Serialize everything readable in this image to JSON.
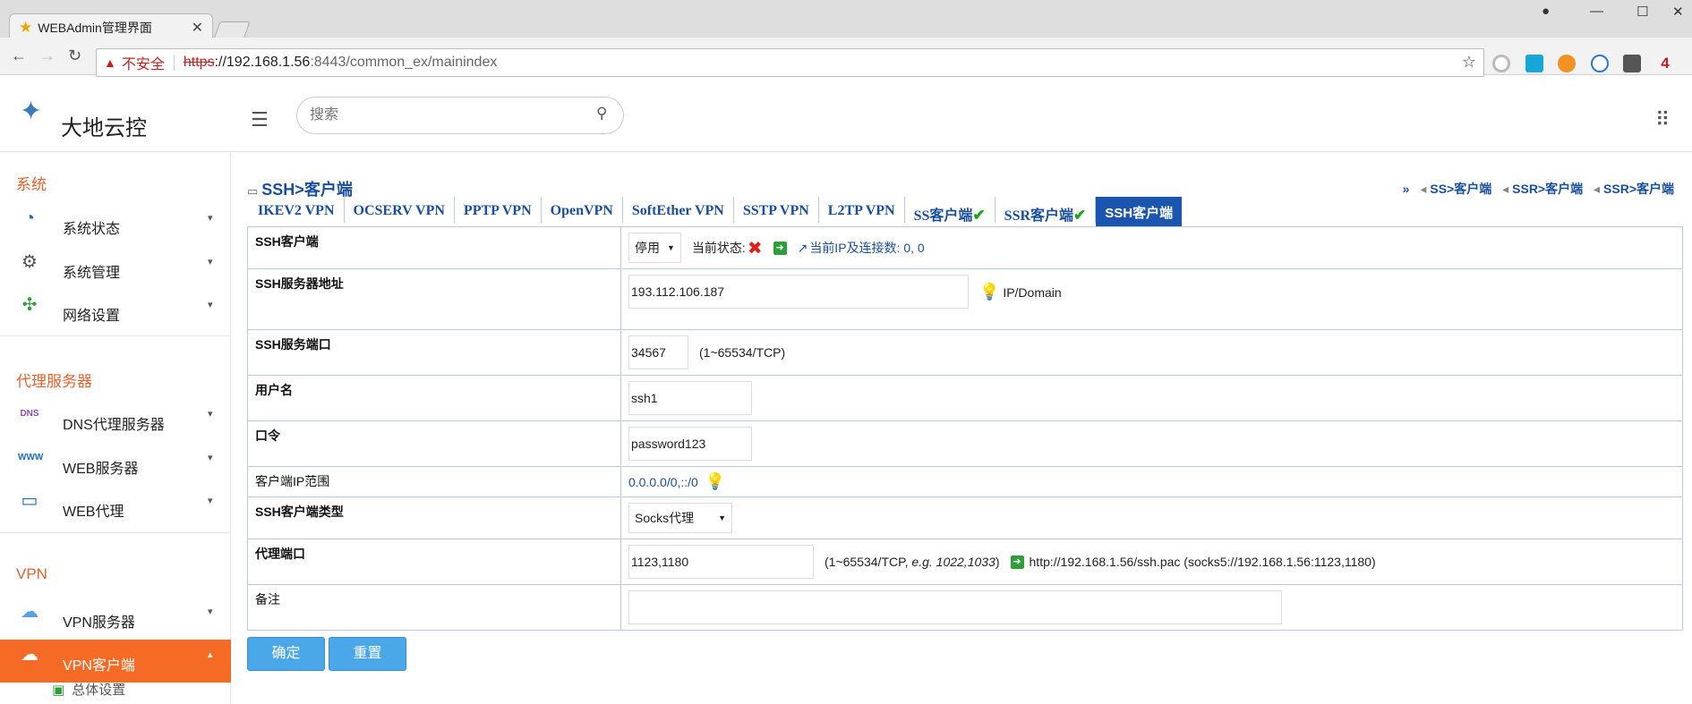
{
  "browser": {
    "tab_title": "WEBAdmin管理界面",
    "close": "✕",
    "warn_glyph": "▲",
    "insecure_label": "不安全",
    "url_scheme": "https",
    "url_host": "://192.168.1.56",
    "url_path": ":8443/common_ex/mainindex",
    "star": "☆",
    "user_icon": "●",
    "minimize": "—",
    "maximize": "☐",
    "window_close": "✕"
  },
  "header": {
    "brand": "大地云控",
    "search_placeholder": "搜索"
  },
  "sidebar": {
    "sections": [
      {
        "title": "系统"
      },
      {
        "title": "代理服务器"
      },
      {
        "title": "VPN"
      }
    ],
    "items": [
      {
        "label": "系统状态",
        "icon": "gauge-icon"
      },
      {
        "label": "系统管理",
        "icon": "gear-icon"
      },
      {
        "label": "网络设置",
        "icon": "network-icon"
      },
      {
        "label": "DNS代理服务器",
        "icon": "dns-icon"
      },
      {
        "label": "WEB服务器",
        "icon": "globe-icon"
      },
      {
        "label": "WEB代理",
        "icon": "monitor-icon"
      },
      {
        "label": "VPN服务器",
        "icon": "cloud-lightning-icon"
      },
      {
        "label": "VPN客户端",
        "icon": "cloud-icon"
      }
    ],
    "sub_item": "总体设置"
  },
  "page": {
    "title": "SSH>客户端",
    "crumb_prefix": "»",
    "crumbs": [
      "SS>客户端",
      "SSR>客户端",
      "SSR>客户端"
    ],
    "tabs": [
      "IKEV2 VPN",
      "OCSERV VPN",
      "PPTP VPN",
      "OpenVPN",
      "SoftEther VPN",
      "SSTP VPN",
      "L2TP VPN",
      "SS客户端",
      "SSR客户端",
      "SSH客户端"
    ],
    "checkmark": "✔"
  },
  "form": {
    "rows": [
      {
        "label": "SSH客户端"
      },
      {
        "label": "SSH服务器地址"
      },
      {
        "label": "SSH服务端口"
      },
      {
        "label": "用户名"
      },
      {
        "label": "口令"
      },
      {
        "label": "客户端IP范围"
      },
      {
        "label": "SSH客户端类型"
      },
      {
        "label": "代理端口"
      },
      {
        "label": "备注"
      }
    ],
    "status_select": "停用",
    "status_label": "当前状态:",
    "status_icon": "✖",
    "ip_conn_link": "当前IP及连接数: 0, 0",
    "server_address": "193.112.106.187",
    "server_address_hint": "IP/Domain",
    "port": "34567",
    "port_hint": "(1~65534/TCP)",
    "username": "ssh1",
    "password": "password123",
    "ip_range": "0.0.0.0/0,::/0",
    "client_type": "Socks代理",
    "proxy_port": "1123,1180",
    "proxy_hint_a": "(1~65534/TCP, ",
    "proxy_hint_eg": "e.g. 1022,1033",
    "proxy_hint_b": ")",
    "pac_link": "http://192.168.1.56/ssh.pac (socks5://192.168.1.56:1123,1180)",
    "remark": ""
  },
  "buttons": {
    "confirm": "确定",
    "reset": "重置"
  }
}
